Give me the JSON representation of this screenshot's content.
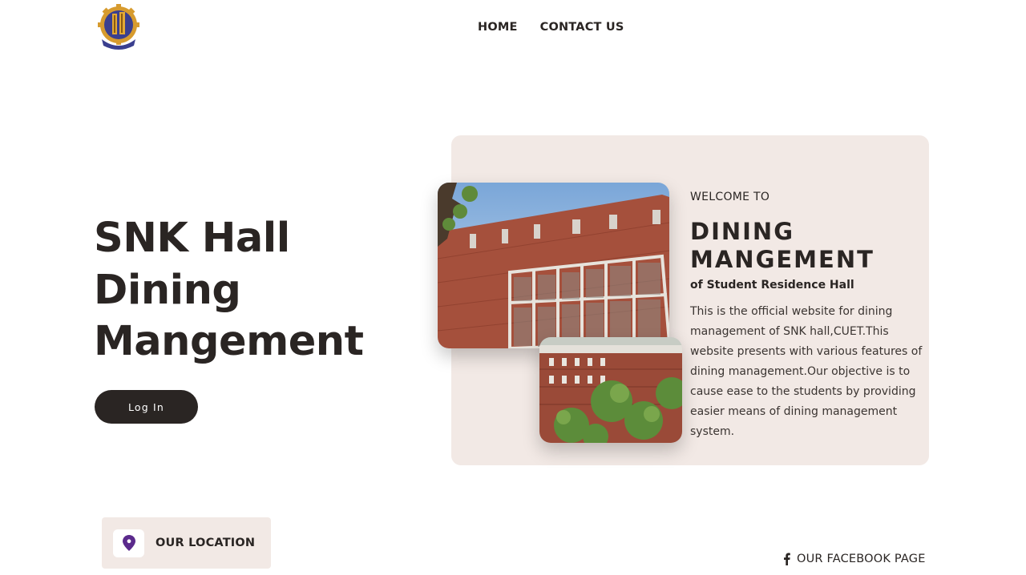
{
  "header": {
    "logo": "university-emblem",
    "nav": [
      {
        "label": "HOME"
      },
      {
        "label": "CONTACT US"
      }
    ]
  },
  "hero": {
    "title_lines": [
      "SNK Hall",
      "Dining",
      "Mangement"
    ],
    "login_label": "Log In"
  },
  "card": {
    "welcome": "WELCOME TO",
    "title_lines": [
      "DINING",
      "MANGEMENT"
    ],
    "subtitle": "of Student Residence Hall",
    "description": "This is the official website for dining management of SNK hall,CUET.This website presents with various features of dining management.Our objective is to cause ease to the students by providing easier means of dining management system.",
    "photos": [
      "hall-building-front-photo",
      "hall-building-aerial-photo"
    ]
  },
  "footer": {
    "location_label": "OUR LOCATION",
    "location_icon": "map-pin-icon",
    "facebook_label": "OUR FACEBOOK PAGE",
    "facebook_icon": "facebook-icon"
  },
  "colors": {
    "text_dark": "#2a2523",
    "card_background": "#f2e9e5",
    "button_background": "#2a2523",
    "pin_color": "#5b2a8c"
  }
}
